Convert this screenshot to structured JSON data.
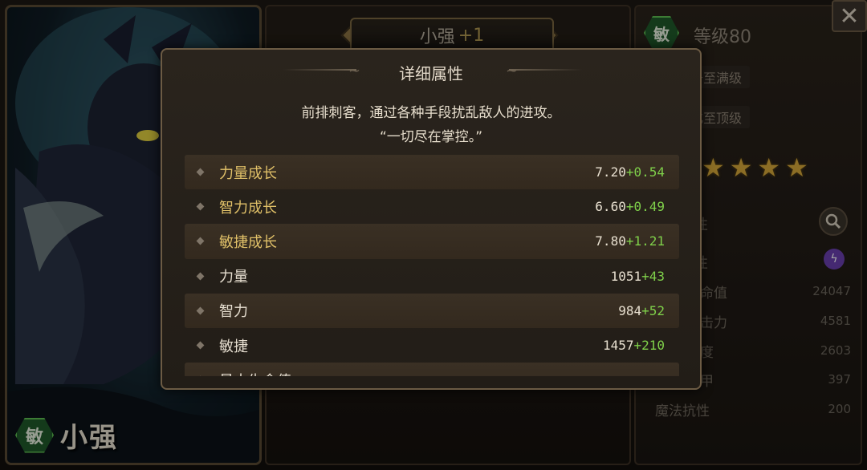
{
  "hero": {
    "name": "小强",
    "plus": "+1",
    "type_badge": "敏",
    "level": "等级80",
    "btn_upgrade": "升至满级",
    "btn_evolve": "化至顶级",
    "star_count": 4,
    "frag_1": "性",
    "frag_2": "性"
  },
  "right_stats": [
    {
      "label": "命值",
      "value": "24047"
    },
    {
      "label": "击力",
      "value": "4581"
    },
    {
      "label": "度",
      "value": "2603"
    },
    {
      "label": "甲",
      "value": "397"
    },
    {
      "label": "魔法抗性",
      "value": "200"
    }
  ],
  "modal": {
    "title": "详细属性",
    "desc_line1": "前排刺客，通过各种手段扰乱敌人的进攻。",
    "desc_line2": "“一切尽在掌控。”",
    "attributes": [
      {
        "label": "力量成长",
        "value": "7.20",
        "bonus": "+0.54"
      },
      {
        "label": "智力成长",
        "value": "6.60",
        "bonus": "+0.49"
      },
      {
        "label": "敏捷成长",
        "value": "7.80",
        "bonus": "+1.21"
      },
      {
        "label": "力量",
        "value": "1051",
        "bonus": "+43"
      },
      {
        "label": "智力",
        "value": "984",
        "bonus": "+52"
      },
      {
        "label": "敏捷",
        "value": "1457",
        "bonus": "+210"
      },
      {
        "label": "最大生命值",
        "value": "",
        "bonus": ""
      }
    ]
  },
  "icons": {
    "close": "close-icon",
    "search": "search-icon",
    "lightning": "lightning-icon",
    "star": "star-icon",
    "diamond": "diamond-bullet-icon"
  },
  "colors": {
    "gold_label": "#e0c068",
    "bonus_green": "#7fd04a",
    "agility_green": "#5fbf52"
  }
}
